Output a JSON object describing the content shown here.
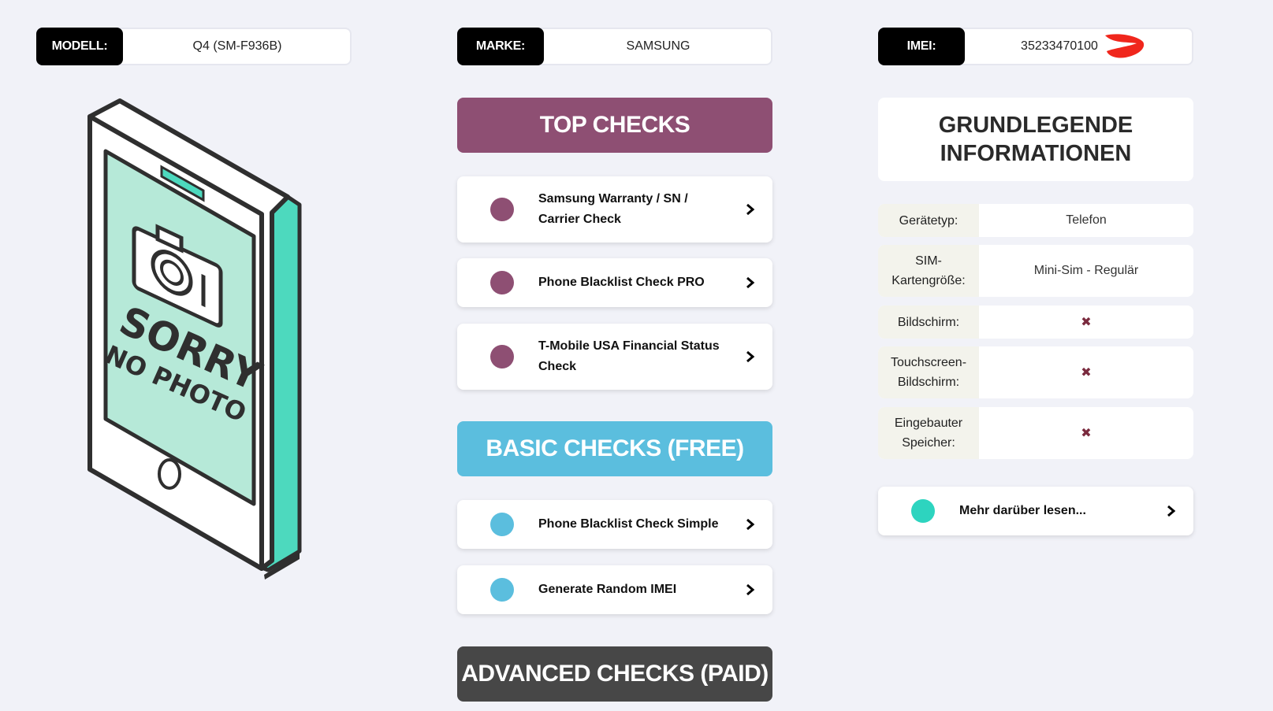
{
  "fields": {
    "modell": {
      "label": "MODELL:",
      "value": "Q4 (SM-F936B)"
    },
    "marke": {
      "label": "MARKE:",
      "value": "SAMSUNG"
    },
    "imei": {
      "label": "IMEI:",
      "value": "35233470100"
    }
  },
  "placeholder_image": {
    "line1": "SORRY",
    "line2": "NO PHOTO"
  },
  "top_checks": {
    "title": "TOP CHECKS",
    "color": "#8e4f73",
    "items": [
      {
        "label": "Samsung Warranty / SN / Carrier Check"
      },
      {
        "label": "Phone Blacklist Check PRO"
      },
      {
        "label": "T-Mobile USA Financial Status Check"
      }
    ]
  },
  "basic_checks": {
    "title": "BASIC CHECKS (FREE)",
    "color": "#5bbede",
    "items": [
      {
        "label": "Phone Blacklist Check Simple"
      },
      {
        "label": "Generate Random IMEI"
      }
    ]
  },
  "advanced_checks": {
    "title": "ADVANCED CHECKS (PAID)",
    "color": "#474747"
  },
  "info": {
    "title_line1": "GRUNDLEGENDE",
    "title_line2": "INFORMATIONEN",
    "rows": [
      {
        "key": "Gerätetyp:",
        "value": "Telefon"
      },
      {
        "key": "SIM-Kartengröße:",
        "key_line1": "SIM-",
        "key_line2": "Kartengröße:",
        "value": "Mini-Sim - Regulär"
      },
      {
        "key": "Bildschirm:",
        "value": "✖"
      },
      {
        "key": "Touchscreen-Bildschirm:",
        "key_line1": "Touchscreen-",
        "key_line2": "Bildschirm:",
        "value": "✖"
      },
      {
        "key": "Eingebauter Speicher:",
        "key_line1": "Eingebauter",
        "key_line2": "Speicher:",
        "value": "✖"
      }
    ],
    "more": {
      "label": "Mehr darüber lesen...",
      "color": "#2dd4bf"
    }
  },
  "icons": {
    "chevron": "chevron-right-icon",
    "camera": "camera-icon",
    "x": "x-mark-icon"
  }
}
